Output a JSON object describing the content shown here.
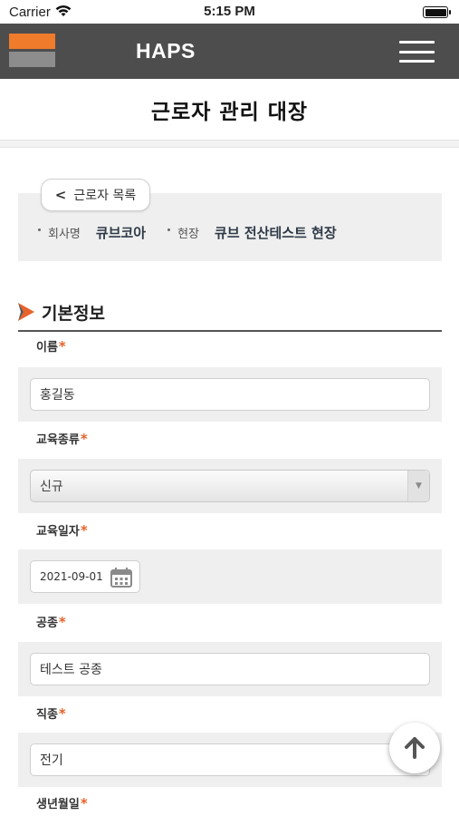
{
  "status_bar": {
    "carrier": "Carrier",
    "time": "5:15 PM"
  },
  "header": {
    "app_title": "HAPS"
  },
  "page": {
    "title": "근로자 관리 대장"
  },
  "info": {
    "back_label": "근로자 목록",
    "company_label": "회사명",
    "company_value": "큐브코아",
    "site_label": "현장",
    "site_value": "큐브 전산테스트 현장"
  },
  "section": {
    "title": "기본정보"
  },
  "fields": {
    "name": {
      "label": "이름",
      "value": "홍길동"
    },
    "edu_type": {
      "label": "교육종류",
      "value": "신규"
    },
    "edu_date": {
      "label": "교육일자",
      "value": "2021-09-01"
    },
    "trade": {
      "label": "공종",
      "value": "테스트 공종"
    },
    "job": {
      "label": "직종",
      "value": "전기"
    },
    "birth": {
      "label": "생년월일"
    }
  },
  "required_mark": "*",
  "colors": {
    "header_bg": "#4d4d4d",
    "logo_orange": "#f07b2a",
    "logo_gray": "#8d8d8d",
    "required": "#e8622a"
  }
}
